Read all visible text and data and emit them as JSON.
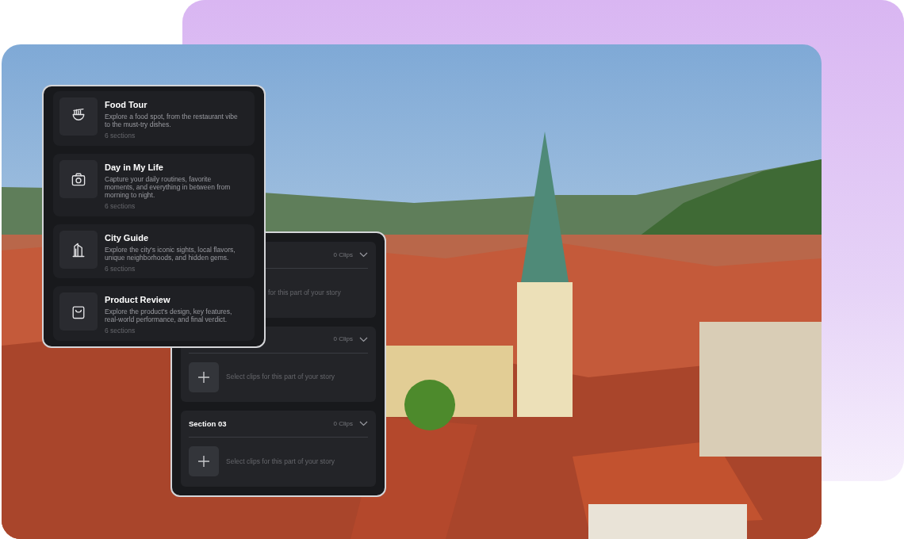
{
  "templates": [
    {
      "title": "Food Tour",
      "description": "Explore a food spot, from the restaurant vibe to the must-try dishes.",
      "count": "6 sections",
      "kind": "bowl"
    },
    {
      "title": "Day in My Life",
      "description": "Capture your daily routines, favorite moments, and everything in between from morning to night.",
      "count": "6 sections",
      "kind": "camera"
    },
    {
      "title": "City Guide",
      "description": "Explore the city's iconic sights, local flavors, unique neighborhoods, and hidden gems.",
      "count": "6 sections",
      "kind": "building"
    },
    {
      "title": "Product Review",
      "description": "Explore the product's design, key features, real-world performance, and final verdict.",
      "count": "6 sections",
      "kind": "bag"
    }
  ],
  "sections": [
    {
      "clips": "0 Clips",
      "hint": "for this part of your story",
      "add_button": false
    },
    {
      "clips": "0 Clips",
      "hint": "Select clips for this part of your story",
      "add_button": true
    },
    {
      "title": "Section 03",
      "clips": "0 Clips",
      "hint": "Select clips for this part of your story",
      "add_button": true
    }
  ]
}
